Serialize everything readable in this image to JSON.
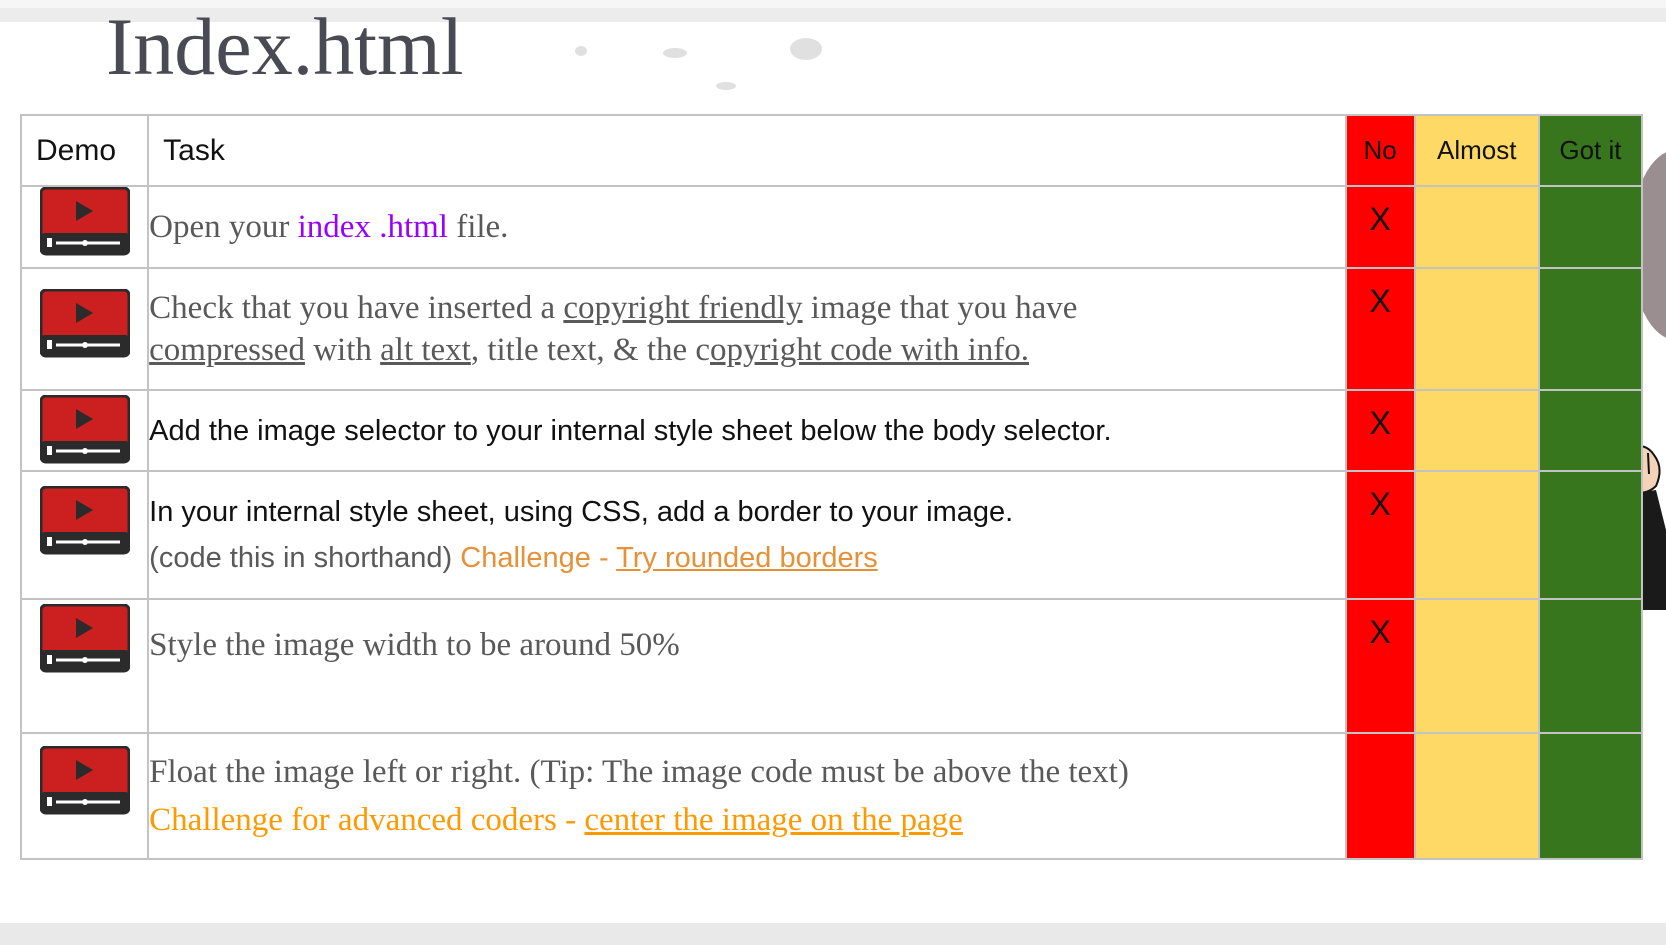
{
  "slide": {
    "title": "Index.html"
  },
  "table": {
    "headers": {
      "demo": "Demo",
      "task": "Task",
      "no": "No",
      "almost": "Almost",
      "got_it": "Got it"
    },
    "rows": [
      {
        "parts": [
          {
            "text": "Open your "
          },
          {
            "text": "index .html",
            "style": "purple"
          },
          {
            "text": " file."
          }
        ],
        "no_mark": "X"
      },
      {
        "parts": [
          {
            "text": "Check that you have inserted a "
          },
          {
            "text": "copyright friendly",
            "style": "underline"
          },
          {
            "text": "  image that you have "
          },
          {
            "text": "compressed",
            "style": "underline"
          },
          {
            "text": " with  "
          },
          {
            "text": "alt text",
            "style": "underline"
          },
          {
            "text": ", title text, & the c"
          },
          {
            "text": "opyright code with info.",
            "style": "underline"
          }
        ],
        "no_mark": "X"
      },
      {
        "text": "Add the image selector to your internal style sheet below the body selector.",
        "no_mark": "X"
      },
      {
        "line1": "In your internal style sheet, using CSS,  add a border to your image.",
        "line2_prefix": "(code this in shorthand) ",
        "challenge_label": "Challenge - ",
        "challenge_link": "Try rounded borders",
        "no_mark": "X"
      },
      {
        "text": "Style the image width to be around 50%",
        "no_mark": "X"
      },
      {
        "line1": "Float the image left or right. (Tip: The image code must be above the text)",
        "challenge_label": "Challenge for advanced coders - ",
        "challenge_link": "center the image on the page",
        "no_mark": ""
      }
    ]
  },
  "colors": {
    "no": "#ff0000",
    "almost": "#ffd966",
    "got_it": "#38761d",
    "link_purple": "#9900ff",
    "challenge_orange": "#ff9900"
  },
  "icons": {
    "demo": "video-play-icon",
    "character": "cartoon-character-fist-icon"
  }
}
